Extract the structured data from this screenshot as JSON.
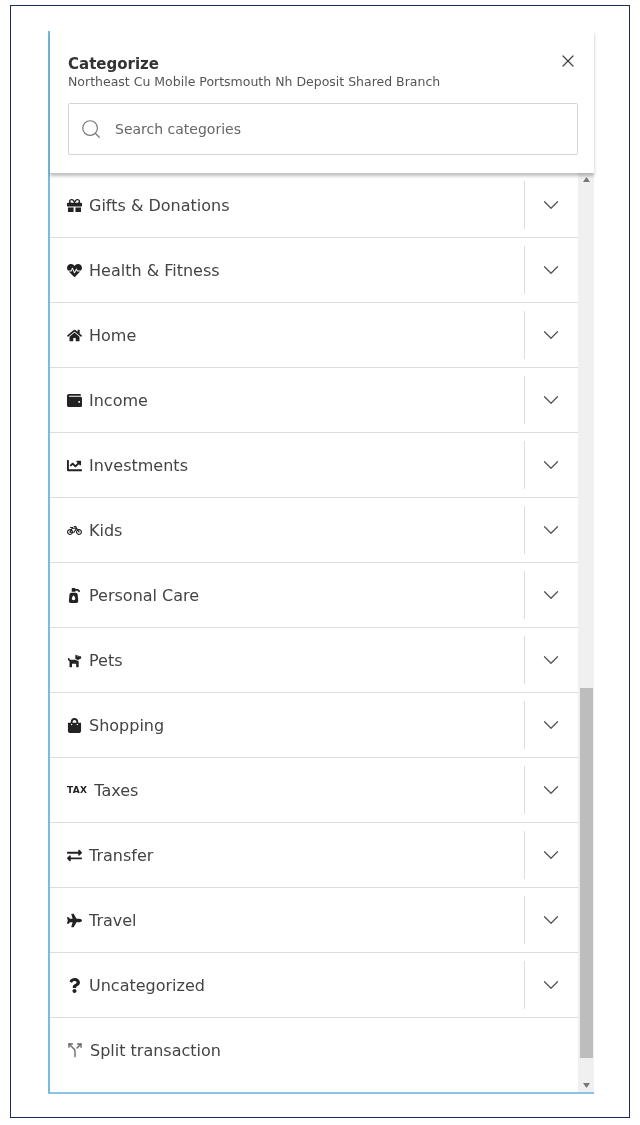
{
  "panel": {
    "title": "Categorize",
    "subtitle": "Northeast Cu Mobile Portsmouth Nh Deposit Shared Branch"
  },
  "search": {
    "placeholder": "Search categories"
  },
  "rows": [
    {
      "kind": "category",
      "label": "Gifts & Donations"
    },
    {
      "kind": "category",
      "label": "Health & Fitness"
    },
    {
      "kind": "category",
      "label": "Home"
    },
    {
      "kind": "category",
      "label": "Income"
    },
    {
      "kind": "category",
      "label": "Investments"
    },
    {
      "kind": "category",
      "label": "Kids"
    },
    {
      "kind": "category",
      "label": "Personal Care"
    },
    {
      "kind": "category",
      "label": "Pets"
    },
    {
      "kind": "category",
      "label": "Shopping"
    },
    {
      "kind": "category",
      "icon_text": "TAX",
      "label": "Taxes"
    },
    {
      "kind": "category",
      "label": "Transfer"
    },
    {
      "kind": "category",
      "label": "Travel"
    },
    {
      "kind": "category",
      "label": "Uncategorized"
    },
    {
      "kind": "action",
      "label": "Split transaction"
    }
  ]
}
